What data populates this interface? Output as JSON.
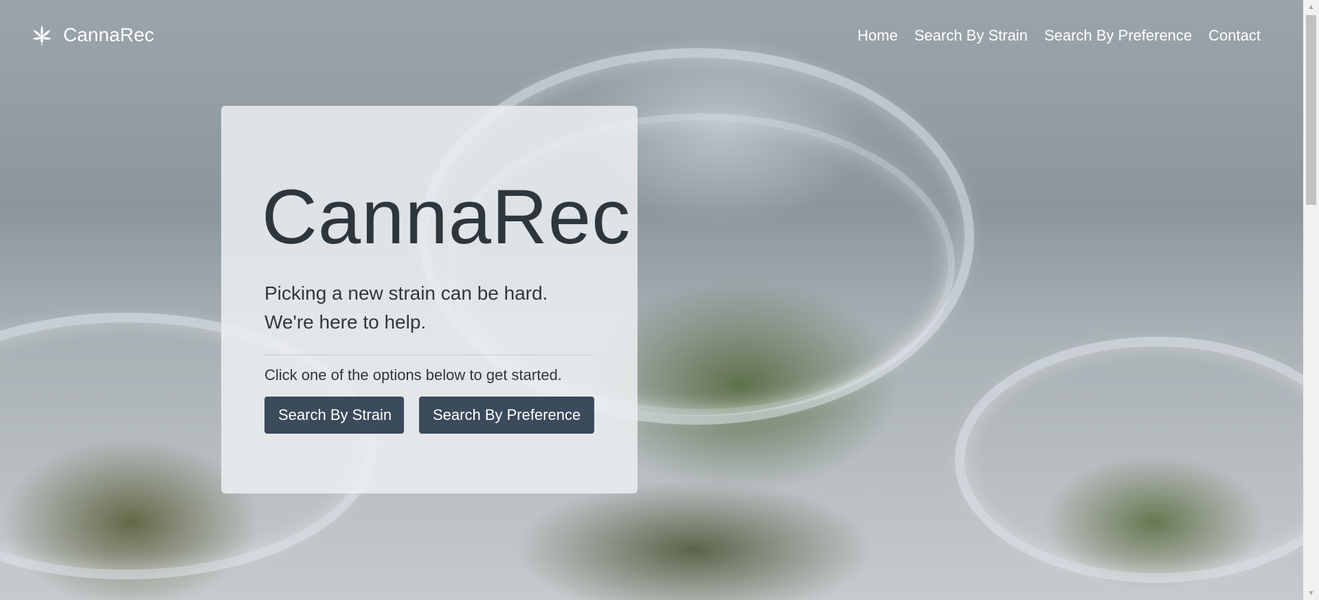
{
  "navbar": {
    "brand": "CannaRec",
    "brand_icon": "cannabis-leaf-icon",
    "links": [
      "Home",
      "Search By Strain",
      "Search By Preference",
      "Contact"
    ]
  },
  "hero": {
    "title": "CannaRec",
    "lead_line1": "Picking a new strain can be hard.",
    "lead_line2": "We're here to help.",
    "subtext": "Click one of the options below to get started.",
    "button_strain": "Search By Strain",
    "button_preference": "Search By Preference"
  },
  "colors": {
    "button_bg": "#3b4b5c",
    "text_dark": "#2e363d",
    "nav_text": "#ffffff"
  },
  "scrollbar": {
    "up_icon": "scroll-up-arrow-icon",
    "down_icon": "scroll-down-arrow-icon"
  }
}
